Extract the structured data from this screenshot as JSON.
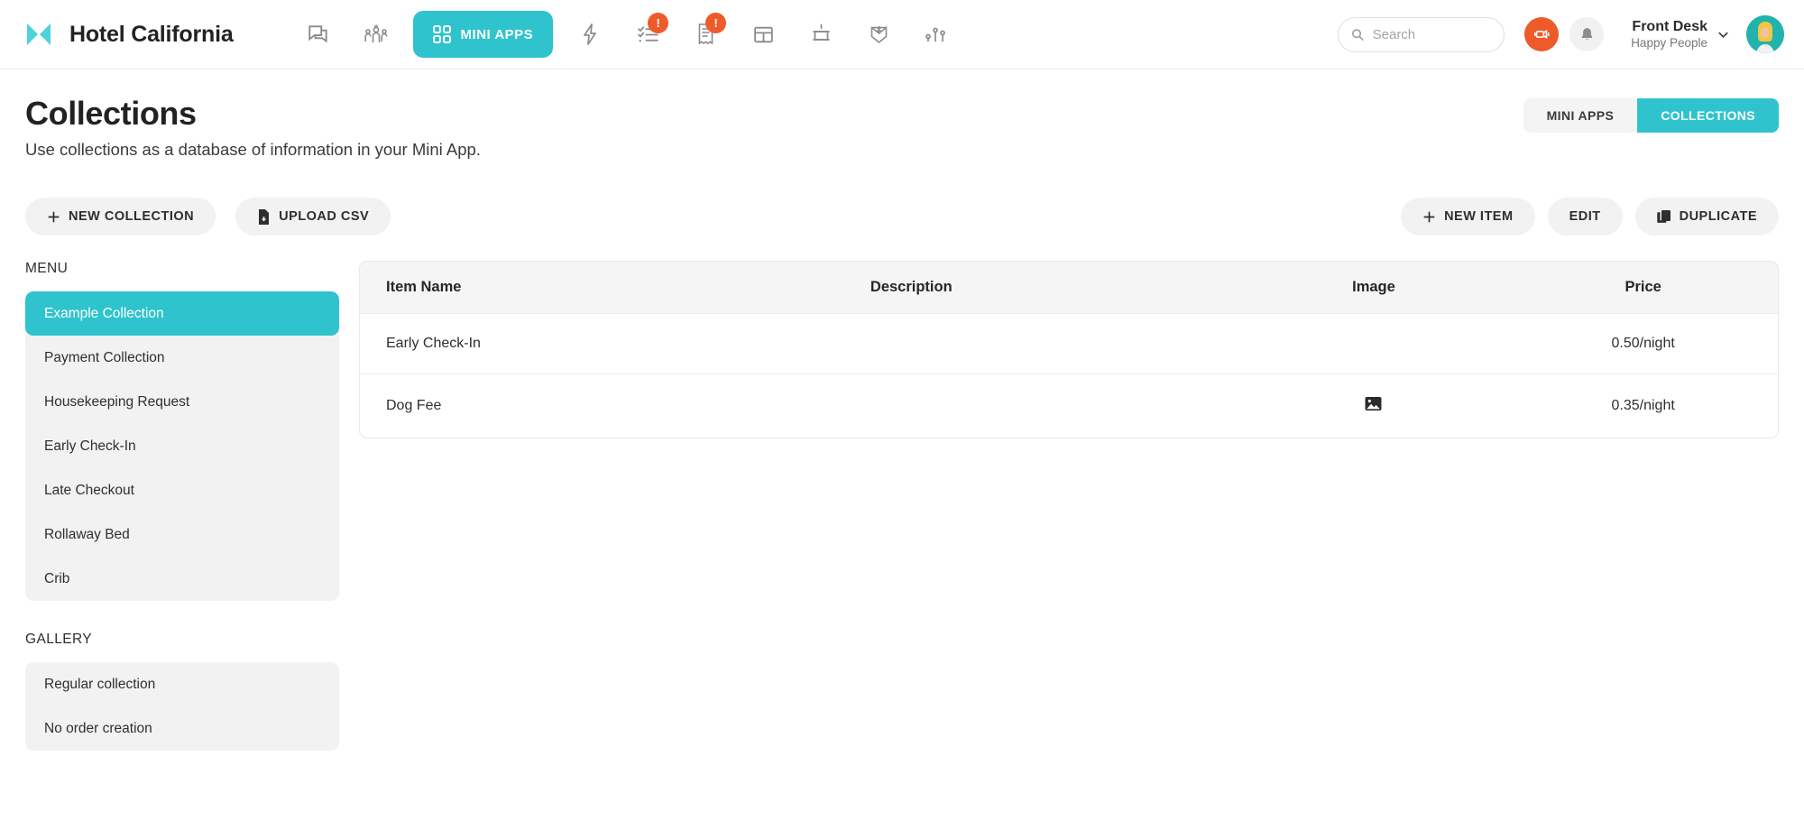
{
  "header": {
    "logo_icon": "bowtie-logo-icon",
    "brand_title": "Hotel California",
    "nav_icons": [
      {
        "name": "chat-icon",
        "badge": null
      },
      {
        "name": "team-icon",
        "badge": null
      },
      {
        "name": "bolt-icon",
        "badge": null
      },
      {
        "name": "checklist-icon",
        "badge": "!"
      },
      {
        "name": "receipt-icon",
        "badge": "!"
      },
      {
        "name": "table-icon",
        "badge": null
      },
      {
        "name": "cart-icon",
        "badge": null
      },
      {
        "name": "invoice-inbox-icon",
        "badge": null
      },
      {
        "name": "analytics-icon",
        "badge": null
      }
    ],
    "mini_apps_button": "MINI APPS",
    "search": {
      "placeholder": "Search",
      "value": "",
      "icon": "search-icon"
    },
    "announcement_icon": "megaphone-icon",
    "notifications_icon": "bell-icon",
    "user": {
      "name": "Front Desk",
      "org": "Happy People",
      "chevron": "chevron-down-icon"
    }
  },
  "page": {
    "title": "Collections",
    "subtitle": "Use collections as a database of information in your Mini App.",
    "toggle": {
      "options": [
        "MINI APPS",
        "COLLECTIONS"
      ],
      "selected": "COLLECTIONS"
    }
  },
  "actions": {
    "left": [
      {
        "label": "NEW COLLECTION",
        "icon": "plus-icon"
      },
      {
        "label": "UPLOAD CSV",
        "icon": "file-upload-icon"
      }
    ],
    "right": [
      {
        "label": "NEW ITEM",
        "icon": "plus-icon"
      },
      {
        "label": "EDIT",
        "icon": null
      },
      {
        "label": "DUPLICATE",
        "icon": "copy-icon"
      }
    ]
  },
  "sidebar": {
    "menu_label": "MENU",
    "menu_items": [
      {
        "label": "Example Collection",
        "selected": true
      },
      {
        "label": "Payment Collection",
        "selected": false
      },
      {
        "label": "Housekeeping Request",
        "selected": false
      },
      {
        "label": "Early Check-In",
        "selected": false
      },
      {
        "label": "Late Checkout",
        "selected": false
      },
      {
        "label": "Rollaway Bed",
        "selected": false
      },
      {
        "label": "Crib",
        "selected": false
      }
    ],
    "gallery_label": "GALLERY",
    "gallery_items": [
      {
        "label": "Regular collection",
        "selected": false
      },
      {
        "label": "No order creation",
        "selected": false
      }
    ]
  },
  "table": {
    "columns": [
      "Item Name",
      "Description",
      "Image",
      "Price"
    ],
    "rows": [
      {
        "item_name": "Early Check-In",
        "description": "",
        "image": "",
        "price": "0.50/night"
      },
      {
        "item_name": "Dog Fee",
        "description": "",
        "image": "image-placeholder-icon",
        "price": "0.35/night"
      }
    ]
  },
  "colors": {
    "accent_teal": "#2fc4cd",
    "accent_orange": "#ef5a2a",
    "panel_grey": "#f2f2f2",
    "text_dark": "#2c2c2c"
  }
}
